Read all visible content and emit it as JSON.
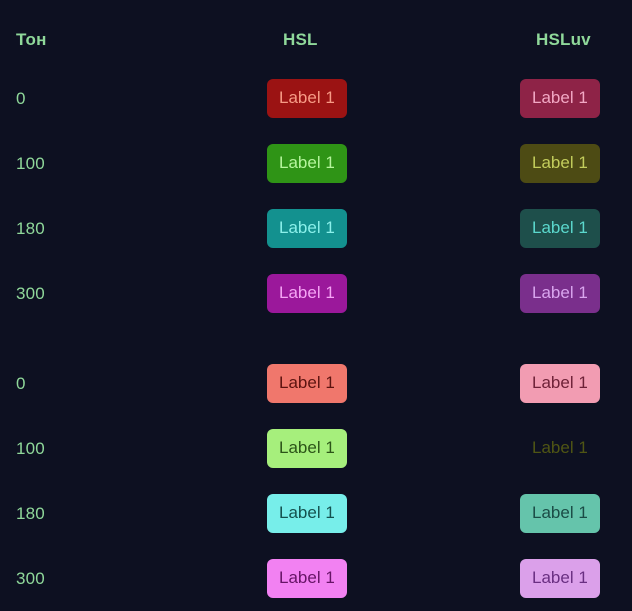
{
  "theme": {
    "background": "#0d1021",
    "header_text_color": "#8fd89a",
    "hue_label_color": "#8fd89a"
  },
  "columns": {
    "hue_header": "Тон",
    "hsl_header": "HSL",
    "hsluv_header": "HSLuv"
  },
  "groups": [
    {
      "name": "dark-group",
      "rows": [
        {
          "hue": "0",
          "hsl": {
            "label": "Label 1",
            "background": "#9b1313",
            "color": "#f79b86"
          },
          "hsluv": {
            "label": "Label 1",
            "background": "#8e2347",
            "color": "#f2a8c4"
          }
        },
        {
          "hue": "100",
          "hsl": {
            "label": "Label 1",
            "background": "#2f9416",
            "color": "#b6f59d"
          },
          "hsluv": {
            "label": "Label 1",
            "background": "#4d4b14",
            "color": "#c3cd5c"
          }
        },
        {
          "hue": "180",
          "hsl": {
            "label": "Label 1",
            "background": "#13918f",
            "color": "#8bf0ea"
          },
          "hsluv": {
            "label": "Label 1",
            "background": "#1e4f4b",
            "color": "#5bd8cd"
          }
        },
        {
          "hue": "300",
          "hsl": {
            "label": "Label 1",
            "background": "#9b189b",
            "color": "#f5a5f5"
          },
          "hsluv": {
            "label": "Label 1",
            "background": "#7a2f8c",
            "color": "#d9a5ee"
          }
        }
      ]
    },
    {
      "name": "light-group",
      "rows": [
        {
          "hue": "0",
          "hsl": {
            "label": "Label 1",
            "background": "#f0776c",
            "color": "#5c1410"
          },
          "hsluv": {
            "label": "Label 1",
            "background": "#f29cb2",
            "color": "#6e2238"
          }
        },
        {
          "hue": "100",
          "hsl": {
            "label": "Label 1",
            "background": "#a6ef7c",
            "color": "#2c5418"
          },
          "hsluv": {
            "label": "Label 1",
            "background": "#b4c css",
            "color": "#4f5514"
          }
        },
        {
          "hue": "180",
          "hsl": {
            "label": "Label 1",
            "background": "#77eeea",
            "color": "#14514e"
          },
          "hsluv": {
            "label": "Label 1",
            "background": "#65c4ab",
            "color": "#1b4c46"
          }
        },
        {
          "hue": "300",
          "hsl": {
            "label": "Label 1",
            "background": "#f281f2",
            "color": "#661466"
          },
          "hsluv": {
            "label": "Label 1",
            "background": "#dba0ea",
            "color": "#6a2f82"
          }
        }
      ]
    }
  ]
}
